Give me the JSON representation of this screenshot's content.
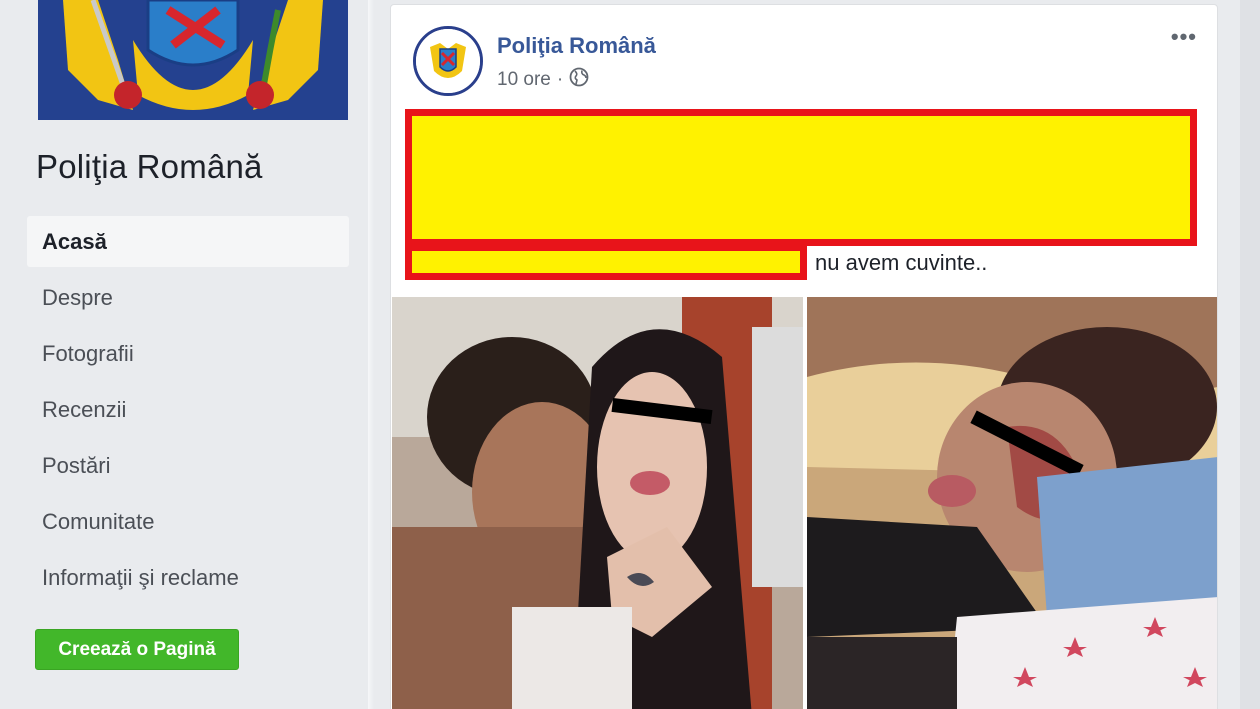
{
  "page": {
    "name": "Poliţia Română"
  },
  "nav": {
    "items": [
      {
        "label": "Acasă",
        "active": true
      },
      {
        "label": "Despre"
      },
      {
        "label": "Fotografii"
      },
      {
        "label": "Recenzii"
      },
      {
        "label": "Postări"
      },
      {
        "label": "Comunitate"
      },
      {
        "label": "Informaţii şi reclame"
      }
    ]
  },
  "create_page_button": "Creează o Pagină",
  "post": {
    "author": "Poliţia Română",
    "time": "10 ore",
    "separator": "·",
    "privacy_icon": "globe-icon",
    "more_icon": "more-dots-icon",
    "text": "nu avem cuvinte..",
    "more_label": "•••"
  },
  "colors": {
    "link_blue": "#385898",
    "green_button": "#42b72a",
    "redaction_yellow": "#fff200",
    "redaction_red": "#e8141a"
  }
}
